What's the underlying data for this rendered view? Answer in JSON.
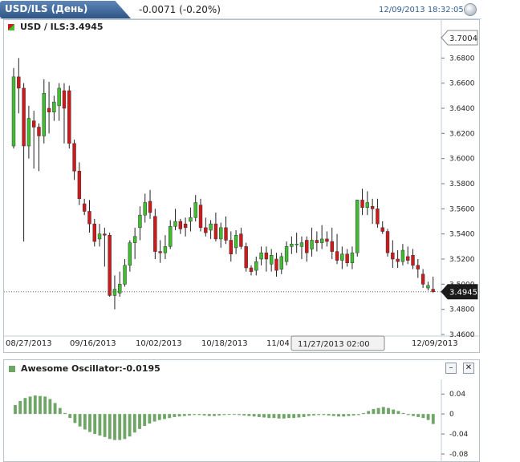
{
  "header": {
    "title": "USD/ILS (День)",
    "change": "-0.0071 (-0.20%)",
    "datetime": "12/09/2013 18:32:05"
  },
  "main_chart": {
    "label": "USD / ILS:3.4945",
    "price_high_marker": "3.7004",
    "price_current_marker": "3.4945",
    "crosshair_label": "11/27/2013 02:00",
    "y_tick_labels": [
      "3.6800",
      "3.6600",
      "3.6400",
      "3.6200",
      "3.6000",
      "3.5800",
      "3.5600",
      "3.5400",
      "3.5200",
      "3.5000",
      "3.4800",
      "3.4600"
    ],
    "x_tick_labels": [
      "08/27/2013",
      "09/16/2013",
      "10/02/2013",
      "10/18/2013",
      "11/04",
      "12/09/2013"
    ]
  },
  "oscillator": {
    "label": "Awesome Oscillator:-0.0195",
    "y_tick_labels": [
      "0.04",
      "0",
      "-0.04",
      "-0.08"
    ],
    "minimize_glyph": "–",
    "close_glyph": "✕"
  },
  "colors": {
    "up": "#3fbf2f",
    "down": "#d0191b",
    "osc": "#6fa668",
    "accent": "#2e5587"
  },
  "chart_data": [
    {
      "type": "candlestick",
      "title": "USD / ILS:3.4945",
      "ylim": [
        3.46,
        3.7
      ],
      "x_tick_labels": [
        "08/27/2013",
        "09/16/2013",
        "10/02/2013",
        "10/18/2013",
        "11/04",
        "12/09/2013"
      ],
      "ohlc": [
        [
          3.61,
          3.672,
          3.608,
          3.665
        ],
        [
          3.665,
          3.68,
          3.636,
          3.656
        ],
        [
          3.656,
          3.66,
          3.534,
          3.61
        ],
        [
          3.61,
          3.642,
          3.6,
          3.632
        ],
        [
          3.63,
          3.638,
          3.592,
          3.625
        ],
        [
          3.625,
          3.628,
          3.59,
          3.618
        ],
        [
          3.618,
          3.663,
          3.612,
          3.652
        ],
        [
          3.64,
          3.661,
          3.62,
          3.637
        ],
        [
          3.637,
          3.65,
          3.63,
          3.645
        ],
        [
          3.642,
          3.66,
          3.63,
          3.656
        ],
        [
          3.654,
          3.66,
          3.612,
          3.64
        ],
        [
          3.654,
          3.658,
          3.608,
          3.612
        ],
        [
          3.612,
          3.615,
          3.583,
          3.59
        ],
        [
          3.59,
          3.597,
          3.563,
          3.568
        ],
        [
          3.564,
          3.568,
          3.555,
          3.558
        ],
        [
          3.558,
          3.567,
          3.541,
          3.548
        ],
        [
          3.548,
          3.552,
          3.53,
          3.534
        ],
        [
          3.536,
          3.548,
          3.53,
          3.54
        ],
        [
          3.54,
          3.545,
          3.514,
          3.539
        ],
        [
          3.539,
          3.541,
          3.49,
          3.491
        ],
        [
          3.491,
          3.507,
          3.48,
          3.496
        ],
        [
          3.493,
          3.51,
          3.49,
          3.5
        ],
        [
          3.5,
          3.52,
          3.498,
          3.515
        ],
        [
          3.515,
          3.535,
          3.51,
          3.533
        ],
        [
          3.533,
          3.545,
          3.52,
          3.538
        ],
        [
          3.545,
          3.562,
          3.535,
          3.555
        ],
        [
          3.555,
          3.572,
          3.549,
          3.565
        ],
        [
          3.566,
          3.575,
          3.552,
          3.557
        ],
        [
          3.554,
          3.56,
          3.52,
          3.526
        ],
        [
          3.526,
          3.535,
          3.517,
          3.525
        ],
        [
          3.525,
          3.539,
          3.52,
          3.53
        ],
        [
          3.53,
          3.551,
          3.528,
          3.546
        ],
        [
          3.546,
          3.56,
          3.543,
          3.55
        ],
        [
          3.55,
          3.552,
          3.54,
          3.544
        ],
        [
          3.548,
          3.553,
          3.538,
          3.545
        ],
        [
          3.55,
          3.561,
          3.542,
          3.553
        ],
        [
          3.553,
          3.571,
          3.55,
          3.565
        ],
        [
          3.563,
          3.568,
          3.542,
          3.545
        ],
        [
          3.545,
          3.553,
          3.538,
          3.541
        ],
        [
          3.543,
          3.551,
          3.536,
          3.548
        ],
        [
          3.548,
          3.557,
          3.534,
          3.536
        ],
        [
          3.536,
          3.549,
          3.529,
          3.545
        ],
        [
          3.545,
          3.554,
          3.532,
          3.535
        ],
        [
          3.535,
          3.542,
          3.518,
          3.524
        ],
        [
          3.529,
          3.543,
          3.524,
          3.539
        ],
        [
          3.54,
          3.545,
          3.528,
          3.53
        ],
        [
          3.53,
          3.533,
          3.51,
          3.513
        ],
        [
          3.513,
          3.515,
          3.507,
          3.51
        ],
        [
          3.511,
          3.522,
          3.507,
          3.518
        ],
        [
          3.52,
          3.53,
          3.515,
          3.525
        ],
        [
          3.525,
          3.53,
          3.51,
          3.52
        ],
        [
          3.516,
          3.528,
          3.51,
          3.523
        ],
        [
          3.52,
          3.525,
          3.506,
          3.511
        ],
        [
          3.512,
          3.525,
          3.508,
          3.522
        ],
        [
          3.518,
          3.534,
          3.515,
          3.53
        ],
        [
          3.53,
          3.538,
          3.524,
          3.532
        ],
        [
          3.532,
          3.541,
          3.525,
          3.532
        ],
        [
          3.53,
          3.538,
          3.52,
          3.533
        ],
        [
          3.535,
          3.538,
          3.518,
          3.525
        ],
        [
          3.528,
          3.545,
          3.522,
          3.535
        ],
        [
          3.535,
          3.542,
          3.526,
          3.533
        ],
        [
          3.533,
          3.547,
          3.528,
          3.536
        ],
        [
          3.536,
          3.542,
          3.53,
          3.534
        ],
        [
          3.534,
          3.545,
          3.52,
          3.526
        ],
        [
          3.526,
          3.54,
          3.516,
          3.519
        ],
        [
          3.519,
          3.53,
          3.512,
          3.524
        ],
        [
          3.524,
          3.528,
          3.514,
          3.517
        ],
        [
          3.517,
          3.53,
          3.512,
          3.525
        ],
        [
          3.525,
          3.566,
          3.522,
          3.567
        ],
        [
          3.567,
          3.576,
          3.555,
          3.561
        ],
        [
          3.561,
          3.574,
          3.555,
          3.565
        ],
        [
          3.562,
          3.568,
          3.548,
          3.56
        ],
        [
          3.56,
          3.568,
          3.545,
          3.548
        ],
        [
          3.545,
          3.55,
          3.54,
          3.542
        ],
        [
          3.542,
          3.544,
          3.522,
          3.525
        ],
        [
          3.525,
          3.535,
          3.513,
          3.52
        ],
        [
          3.52,
          3.527,
          3.513,
          3.518
        ],
        [
          3.518,
          3.532,
          3.515,
          3.527
        ],
        [
          3.522,
          3.53,
          3.516,
          3.519
        ],
        [
          3.523,
          3.528,
          3.512,
          3.515
        ],
        [
          3.515,
          3.52,
          3.505,
          3.512
        ],
        [
          3.508,
          3.512,
          3.497,
          3.5
        ],
        [
          3.497,
          3.502,
          3.495,
          3.499
        ],
        [
          3.496,
          3.506,
          3.493,
          3.494
        ]
      ]
    },
    {
      "type": "bar",
      "title": "Awesome Oscillator:-0.0195",
      "ylim": [
        -0.08,
        0.05
      ],
      "values": [
        0.018,
        0.026,
        0.032,
        0.035,
        0.037,
        0.036,
        0.035,
        0.03,
        0.022,
        0.012,
        0.002,
        -0.008,
        -0.018,
        -0.025,
        -0.031,
        -0.036,
        -0.04,
        -0.043,
        -0.046,
        -0.05,
        -0.052,
        -0.052,
        -0.05,
        -0.045,
        -0.037,
        -0.03,
        -0.024,
        -0.019,
        -0.015,
        -0.012,
        -0.01,
        -0.008,
        -0.006,
        -0.005,
        -0.004,
        -0.003,
        -0.002,
        -0.002,
        -0.003,
        -0.004,
        -0.004,
        -0.003,
        -0.002,
        -0.001,
        -0.001,
        -0.002,
        -0.003,
        -0.004,
        -0.005,
        -0.006,
        -0.007,
        -0.008,
        -0.008,
        -0.009,
        -0.009,
        -0.008,
        -0.008,
        -0.007,
        -0.006,
        -0.004,
        -0.003,
        -0.002,
        -0.002,
        -0.003,
        -0.004,
        -0.005,
        -0.005,
        -0.004,
        -0.003,
        -0.002,
        0.002,
        0.006,
        0.01,
        0.012,
        0.014,
        0.012,
        0.009,
        0.006,
        0.002,
        -0.002,
        -0.004,
        -0.006,
        -0.008,
        -0.012,
        -0.02
      ]
    }
  ]
}
